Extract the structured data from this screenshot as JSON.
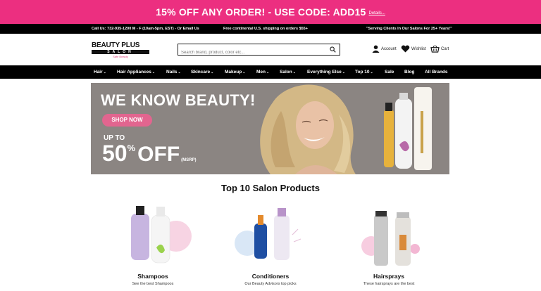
{
  "promo": {
    "text": "15% OFF ANY ORDER! - USE CODE: ADD15",
    "details": "Details..."
  },
  "infobar": {
    "contact": "Call Us: 732-935-1200 M - F (10am-5pm, EST) - Or Email Us",
    "shipping": "Free continental U.S. shipping on orders $55+",
    "serving": "\"Serving Clients In Our Salons For 25+ Years!\""
  },
  "logo": {
    "top": "BEAUTY PLUS",
    "middle": "SALON",
    "sub": "Safe Beauty"
  },
  "search": {
    "placeholder": "Search brand, product, color etc..."
  },
  "header_links": {
    "account": "Account",
    "wishlist": "Wishlist",
    "cart": "Cart"
  },
  "nav": {
    "items": [
      "Hair",
      "Hair Appliances",
      "Nails",
      "Skincare",
      "Makeup",
      "Men",
      "Salon",
      "Everything Else",
      "Top 10",
      "Sale",
      "Blog",
      "All Brands"
    ]
  },
  "hero": {
    "headline": "WE KNOW BEAUTY!",
    "cta": "SHOP NOW",
    "upto": "UP TO",
    "percent": "50",
    "pct_sign": "%",
    "off": "OFF",
    "msrp": "(MSRP)"
  },
  "section": {
    "title": "Top 10 Salon Products"
  },
  "products": [
    {
      "name": "Shampoos",
      "desc": "See the best Shampoos"
    },
    {
      "name": "Conditioners",
      "desc": "Our Beauty Advisors top picks"
    },
    {
      "name": "Hairsprays",
      "desc": "These hairsprays are the best"
    }
  ],
  "colors": {
    "promo_bg": "#ec2f80",
    "nav_bg": "#000000",
    "cta_pink": "#e2658f",
    "hero_bg": "#8b8582"
  }
}
